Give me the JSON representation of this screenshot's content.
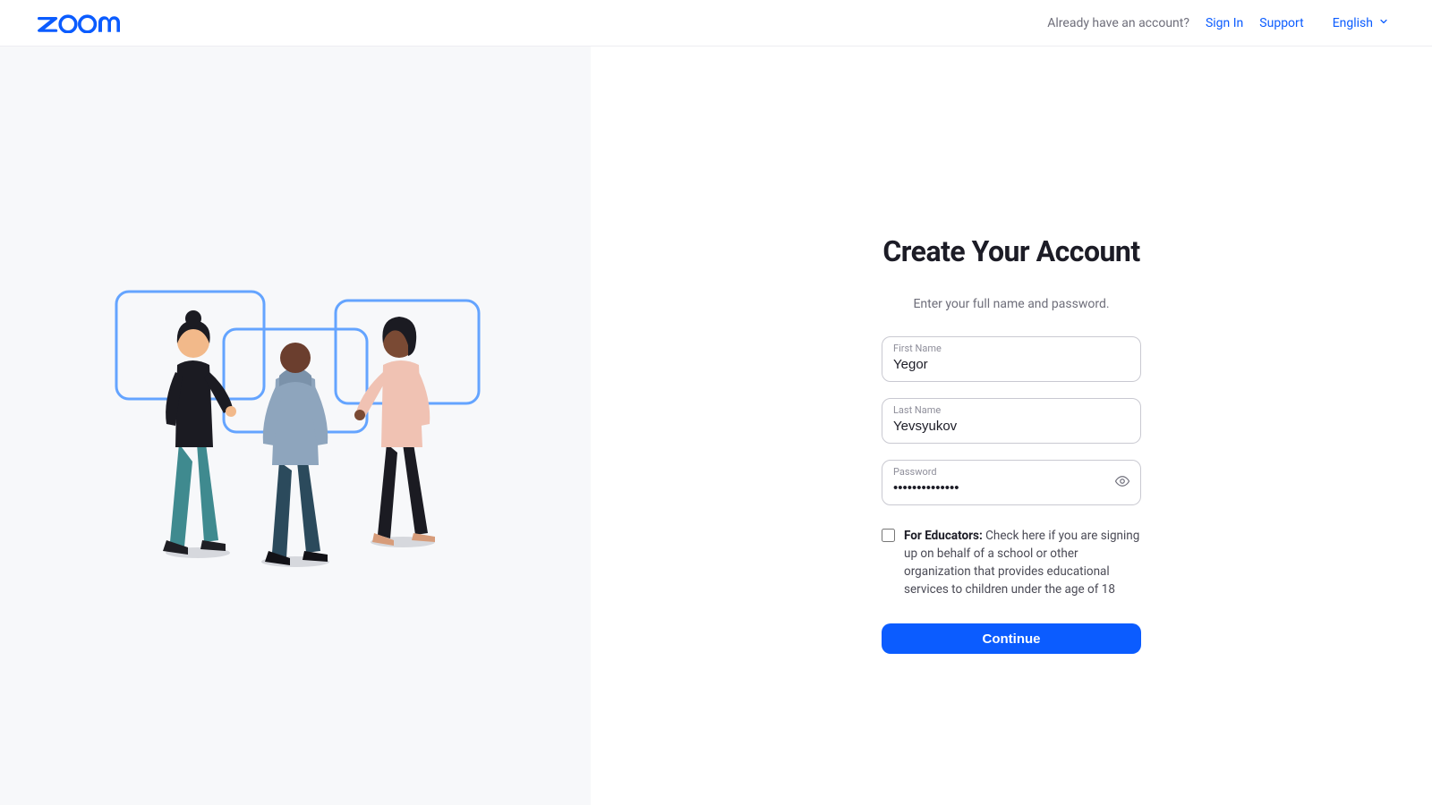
{
  "header": {
    "account_prompt": "Already have an account?",
    "sign_in": "Sign In",
    "support": "Support",
    "language": "English"
  },
  "form": {
    "title": "Create Your Account",
    "subtitle": "Enter your full name and password.",
    "first_name_label": "First Name",
    "first_name_value": "Yegor",
    "last_name_label": "Last Name",
    "last_name_value": "Yevsyukov",
    "password_label": "Password",
    "password_value": "••••••••••••••",
    "educators_bold": "For Educators:",
    "educators_rest": " Check here if you are signing up on behalf of a school or other organization that provides educational services to children under the age of 18",
    "continue": "Continue"
  },
  "colors": {
    "brand_blue": "#0b5cff"
  }
}
